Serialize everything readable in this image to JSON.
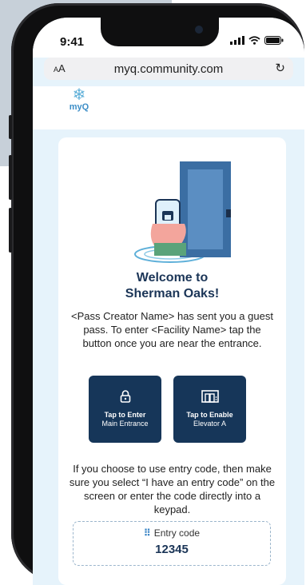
{
  "status_bar": {
    "time": "9:41"
  },
  "browser": {
    "text_size_label": "AA",
    "url": "myq.community.com",
    "reload_icon": "reload-icon"
  },
  "brand": {
    "logo_text": "myQ"
  },
  "welcome": {
    "line1": "Welcome to",
    "line2": "Sherman Oaks!"
  },
  "description": "<Pass Creator Name> has sent you a guest pass. To enter <Facility Name> tap the button once you are near the entrance.",
  "buttons": [
    {
      "line1": "Tap to Enter",
      "line2": "Main Entrance",
      "icon": "lock-icon"
    },
    {
      "line1": "Tap to Enable",
      "line2": "Elevator A",
      "icon": "elevator-icon"
    }
  ],
  "entry_note": "If you choose to use entry code, then make sure you select “I have an entry code” on the screen or enter the code directly into a keypad.",
  "entry_code": {
    "label": "Entry code",
    "value": "12345",
    "icon": "keypad-icon"
  },
  "colors": {
    "primary": "#163659",
    "accent": "#3b86c6",
    "background": "#e6f3fb"
  }
}
